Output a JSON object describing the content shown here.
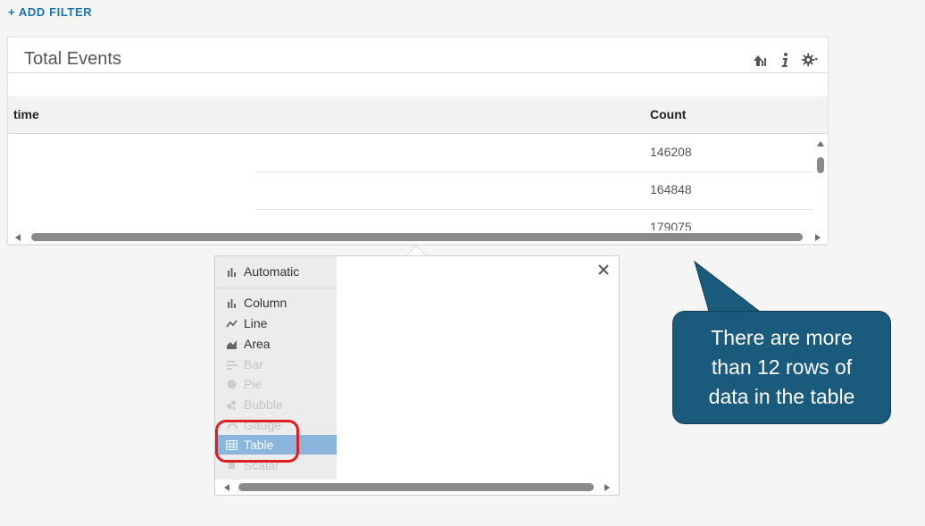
{
  "add_filter": "+ ADD FILTER",
  "widget": {
    "title": "Total Events",
    "tools": [
      "chart-upload-icon",
      "info-icon",
      "gear-icon"
    ]
  },
  "table": {
    "columns": [
      "time",
      "Count"
    ],
    "rows": [
      {
        "time": "",
        "count": "146208"
      },
      {
        "time": "",
        "count": "164848"
      },
      {
        "time": "",
        "count": "179075"
      }
    ]
  },
  "chart_types": {
    "automatic": "Automatic",
    "items": [
      {
        "label": "Column",
        "icon": "column-chart-icon",
        "state": "enabled"
      },
      {
        "label": "Line",
        "icon": "line-chart-icon",
        "state": "enabled"
      },
      {
        "label": "Area",
        "icon": "area-chart-icon",
        "state": "enabled"
      },
      {
        "label": "Bar",
        "icon": "bar-chart-icon",
        "state": "disabled"
      },
      {
        "label": "Pie",
        "icon": "pie-chart-icon",
        "state": "disabled"
      },
      {
        "label": "Bubble",
        "icon": "bubble-chart-icon",
        "state": "disabled"
      },
      {
        "label": "Gauge",
        "icon": "gauge-chart-icon",
        "state": "disabled"
      },
      {
        "label": "Table",
        "icon": "table-icon",
        "state": "selected"
      },
      {
        "label": "Scalar",
        "icon": "scalar-icon",
        "state": "disabled"
      }
    ]
  },
  "callout": "There are more than 12 rows of data in the table",
  "colors": {
    "accent_link": "#1a73b0",
    "selected_item": "#8bb5dc",
    "callout_bg": "#1a5a7c",
    "annotation_red": "#e01e1e"
  }
}
